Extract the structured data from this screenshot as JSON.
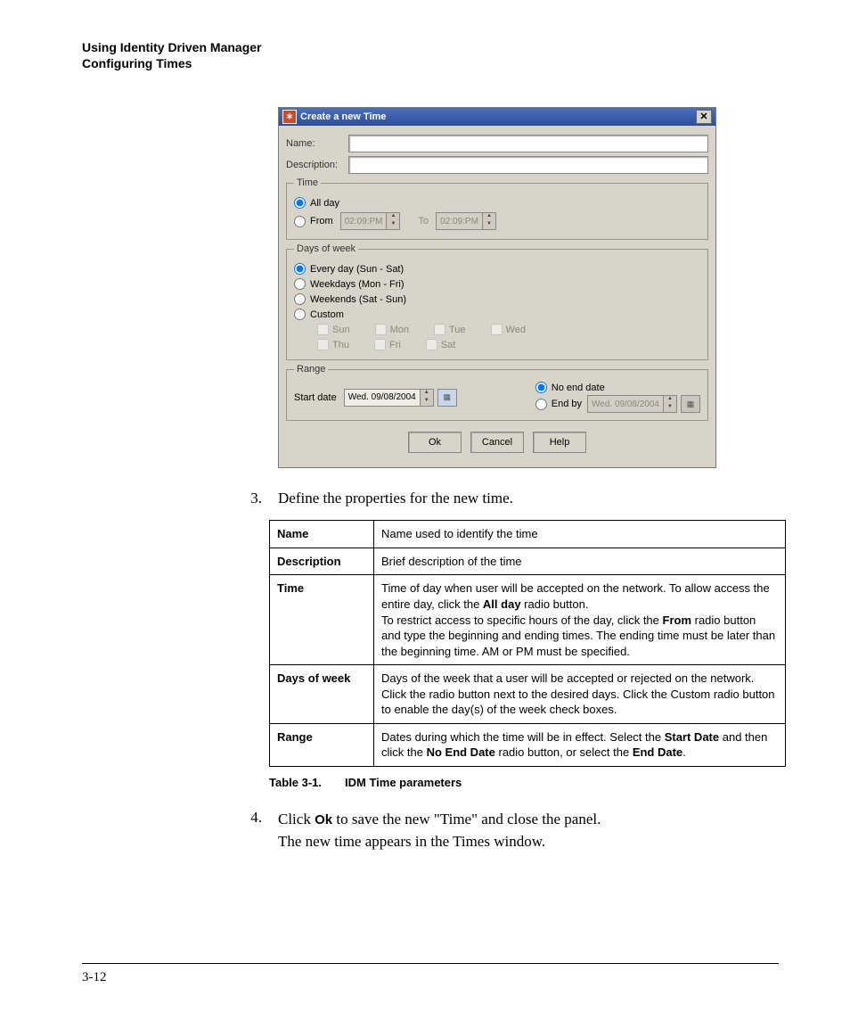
{
  "header": {
    "line1": "Using Identity Driven Manager",
    "line2": "Configuring Times"
  },
  "dialog": {
    "title": "Create a new Time",
    "name_label": "Name:",
    "desc_label": "Description:",
    "time": {
      "legend": "Time",
      "allday": "All day",
      "from": "From",
      "to": "To",
      "from_val": "02:09:PM",
      "to_val": "02:09:PM"
    },
    "dow": {
      "legend": "Days of week",
      "every": "Every day (Sun - Sat)",
      "weekdays": "Weekdays (Mon - Fri)",
      "weekends": "Weekends (Sat - Sun)",
      "custom": "Custom",
      "days": {
        "sun": "Sun",
        "mon": "Mon",
        "tue": "Tue",
        "wed": "Wed",
        "thu": "Thu",
        "fri": "Fri",
        "sat": "Sat"
      }
    },
    "range": {
      "legend": "Range",
      "start_label": "Start date",
      "start_val": "Wed. 09/08/2004",
      "noend": "No end date",
      "endby": "End by",
      "end_val": "Wed. 09/08/2004"
    },
    "buttons": {
      "ok": "Ok",
      "cancel": "Cancel",
      "help": "Help"
    }
  },
  "step3": {
    "num": "3.",
    "text": "Define the properties for the new time."
  },
  "table": [
    {
      "k": "Name",
      "v": "Name used to identify the time"
    },
    {
      "k": "Description",
      "v": "Brief description of the time"
    },
    {
      "k": "Time",
      "v": "Time of day when user will be accepted on the network. To allow access the entire day, click the <b>All day</b> radio button.<br>To restrict access to specific hours of the day, click the <b>From</b> radio button and type the beginning and ending times. The ending time must be later than the beginning time. AM or PM must be specified."
    },
    {
      "k": "Days of week",
      "v": "Days of the week that a user will be accepted or rejected on the network. Click the radio button next to the desired days. Click the Custom radio button to enable the day(s) of the week check boxes."
    },
    {
      "k": "Range",
      "v": "Dates during which the time will be in effect. Select the <b>Start Date</b> and then click the <b>No End Date</b> radio button, or select the <b>End Date</b>."
    }
  ],
  "caption": {
    "label": "Table 3-1.",
    "text": "IDM Time parameters"
  },
  "step4": {
    "num": "4.",
    "line1_pre": "Click ",
    "bold": "Ok",
    "line1_post": " to save the new \"Time\" and close the panel.",
    "line2": "The new time appears in the Times window."
  },
  "pagenum": "3-12"
}
